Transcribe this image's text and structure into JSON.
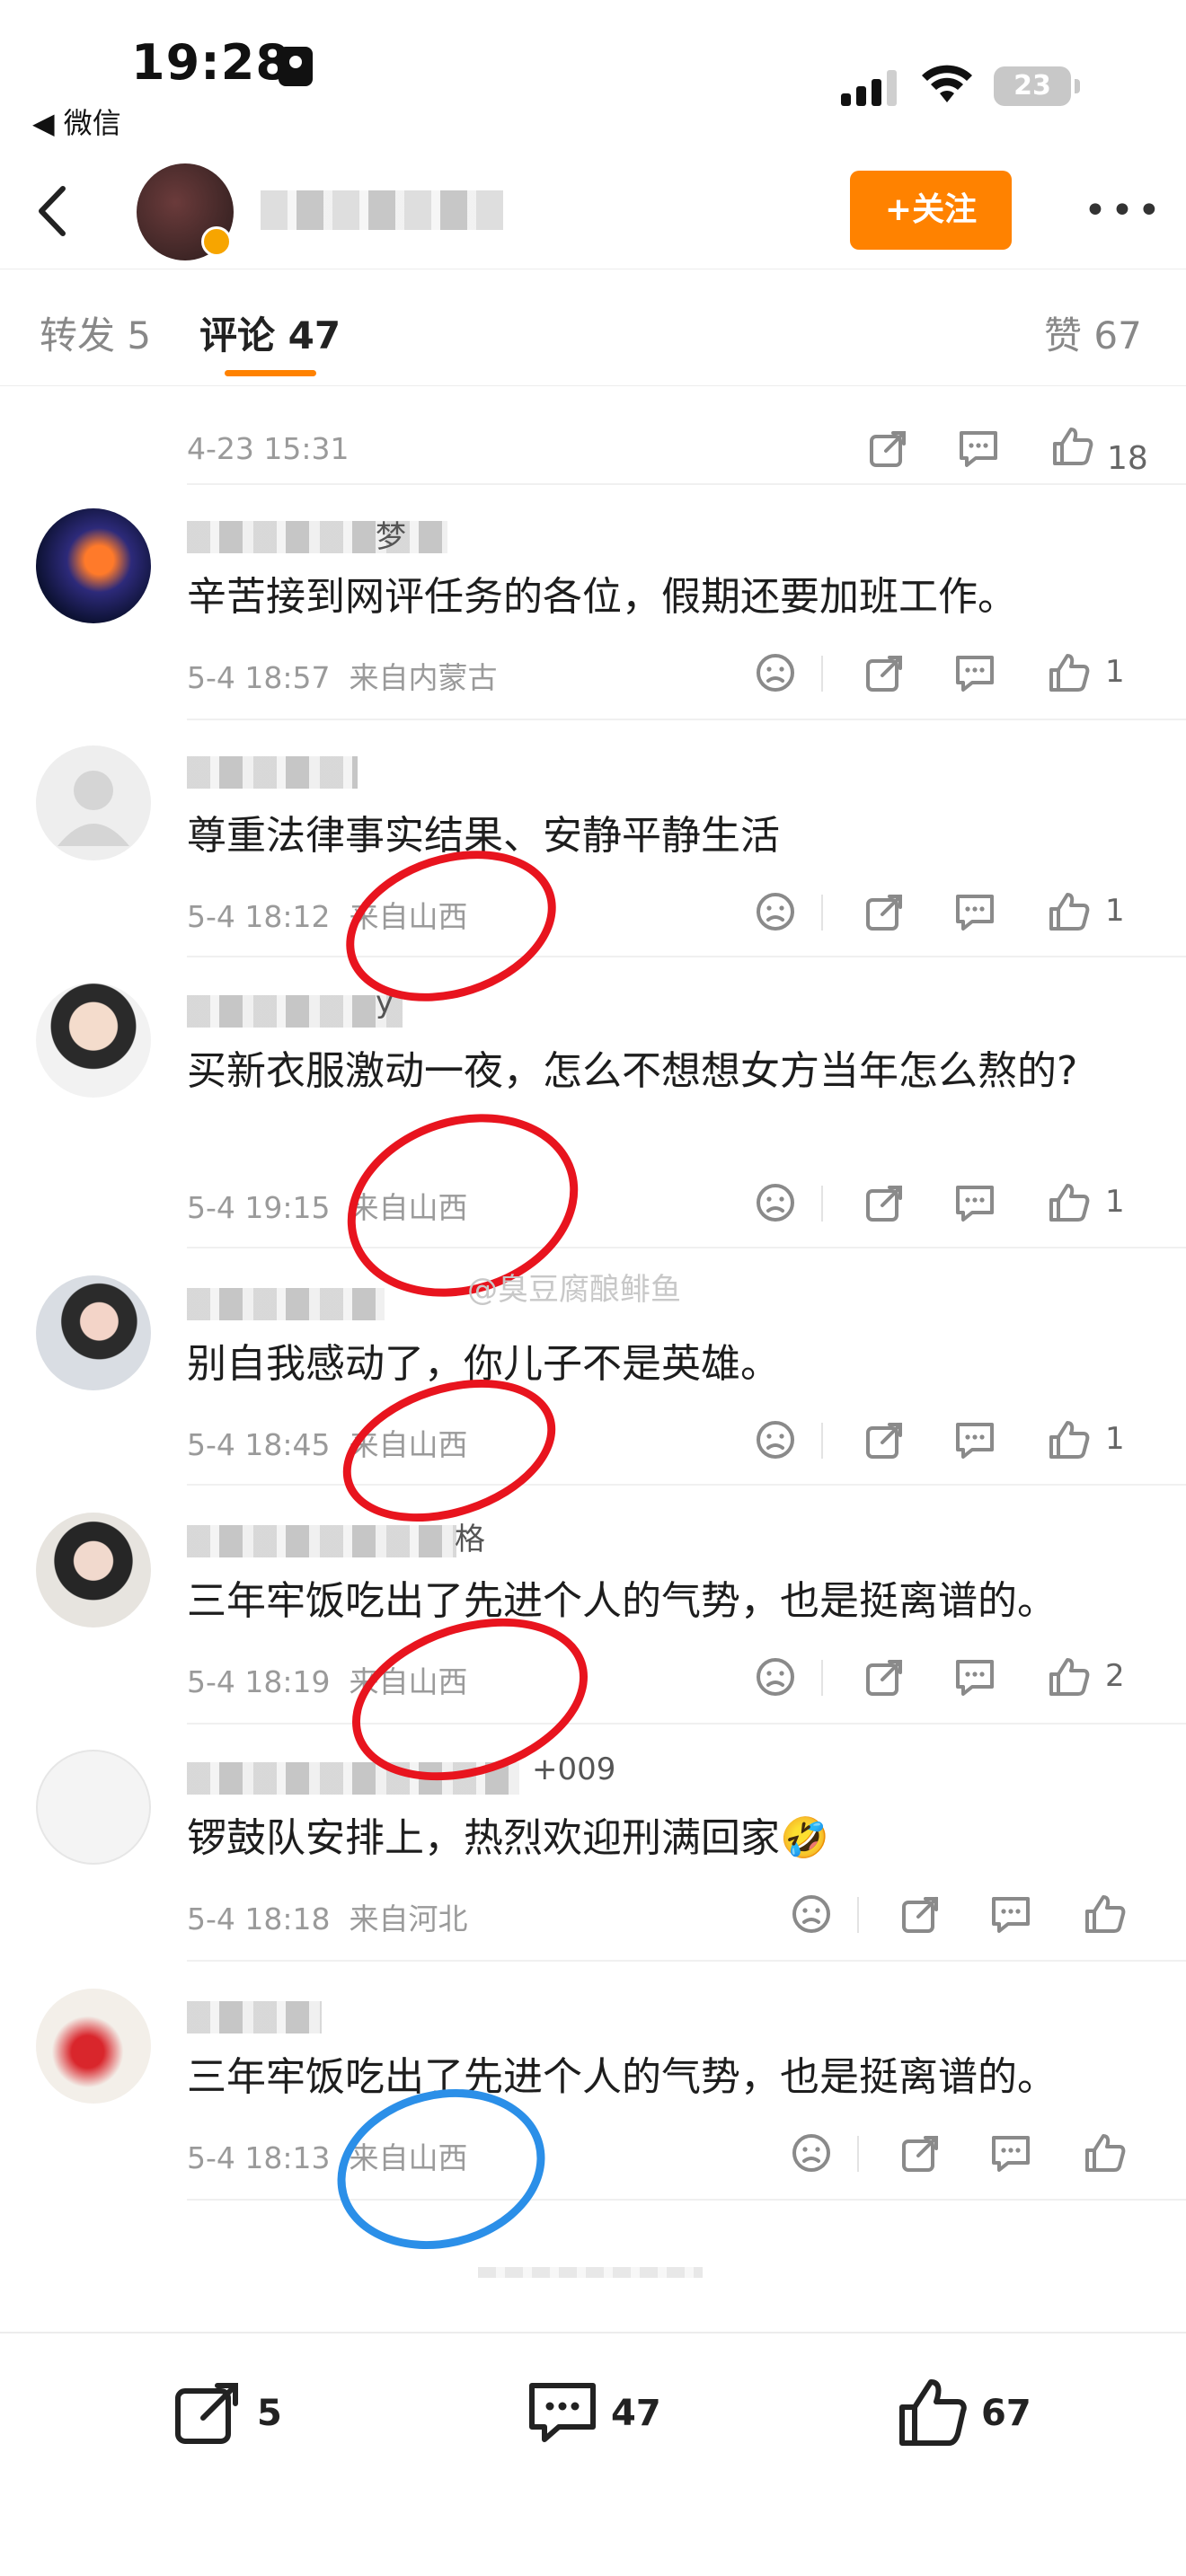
{
  "status_bar": {
    "time": "19:28",
    "back_app": "◀ 微信",
    "battery": "23"
  },
  "header": {
    "back_icon": "chevron-left-icon",
    "follow_label": "+关注",
    "more_icon": "more-horizontal-icon",
    "accent_color": "#ff8200"
  },
  "tabs": {
    "repost": "转发 5",
    "comments": "评论 47",
    "likes": "赞 67"
  },
  "first_item": {
    "time": "4-23 15:31",
    "likes": "18"
  },
  "comments": [
    {
      "name_tail": "梦",
      "text": "辛苦接到网评任务的各位，假期还要加班工作。",
      "time": "5-4 18:57",
      "location": "来自内蒙古",
      "likes": "1"
    },
    {
      "name_tail": "",
      "text": "尊重法律事实结果、安静平静生活",
      "time": "5-4 18:12",
      "location": "来自山西",
      "likes": "1"
    },
    {
      "name_tail": "y",
      "text": "买新衣服激动一夜，怎么不想想女方当年怎么熬的?",
      "time": "5-4 19:15",
      "location": "来自山西",
      "likes": "1"
    },
    {
      "name_tail": "",
      "text": "别自我感动了，你儿子不是英雄。",
      "time": "5-4 18:45",
      "location": "来自山西",
      "likes": "1"
    },
    {
      "name_tail": "格",
      "text": "三年牢饭吃出了先进个人的气势，也是挺离谱的。",
      "time": "5-4 18:19",
      "location": "来自山西",
      "likes": "2"
    },
    {
      "name_tail": "+009",
      "text": "锣鼓队安排上，热烈欢迎刑满回家🤣",
      "time": "5-4 18:18",
      "location": "来自河北",
      "likes": ""
    },
    {
      "name_tail": "",
      "text": "三年牢饭吃出了先进个人的气势，也是挺离谱的。",
      "time": "5-4 18:13",
      "location": "来自山西",
      "likes": ""
    }
  ],
  "watermark": "@臭豆腐酿鲱鱼",
  "bottom_bar": {
    "repost_count": "5",
    "comment_count": "47",
    "like_count": "67"
  }
}
